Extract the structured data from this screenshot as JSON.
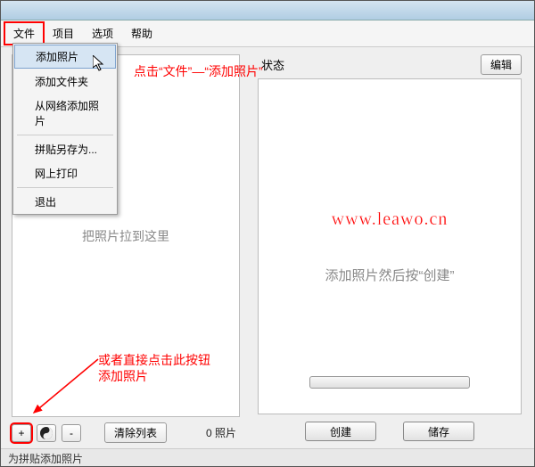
{
  "menubar": {
    "file": "文件",
    "project": "项目",
    "options": "选项",
    "help": "帮助"
  },
  "dropdown": {
    "add_photo": "添加照片",
    "add_folder": "添加文件夹",
    "add_from_web": "从网络添加照片",
    "save_collage_as": "拼贴另存为...",
    "web_print": "网上打印",
    "exit": "退出"
  },
  "left": {
    "drop_hint": "把照片拉到这里",
    "clear_list": "清除列表",
    "photo_count": "0 照片",
    "plus": "+",
    "minus": "-"
  },
  "right": {
    "status_label": "状态",
    "edit_btn": "编辑",
    "watermark": "www.leawo.cn",
    "preview_hint": "添加照片然后按“创建”",
    "create_btn": "创建",
    "save_btn": "储存"
  },
  "statusbar": "为拼贴添加照片",
  "annotations": {
    "top": "点击“文件”—“添加照片”",
    "bottom_line1": "或者直接点击此按钮",
    "bottom_line2": "添加照片"
  }
}
